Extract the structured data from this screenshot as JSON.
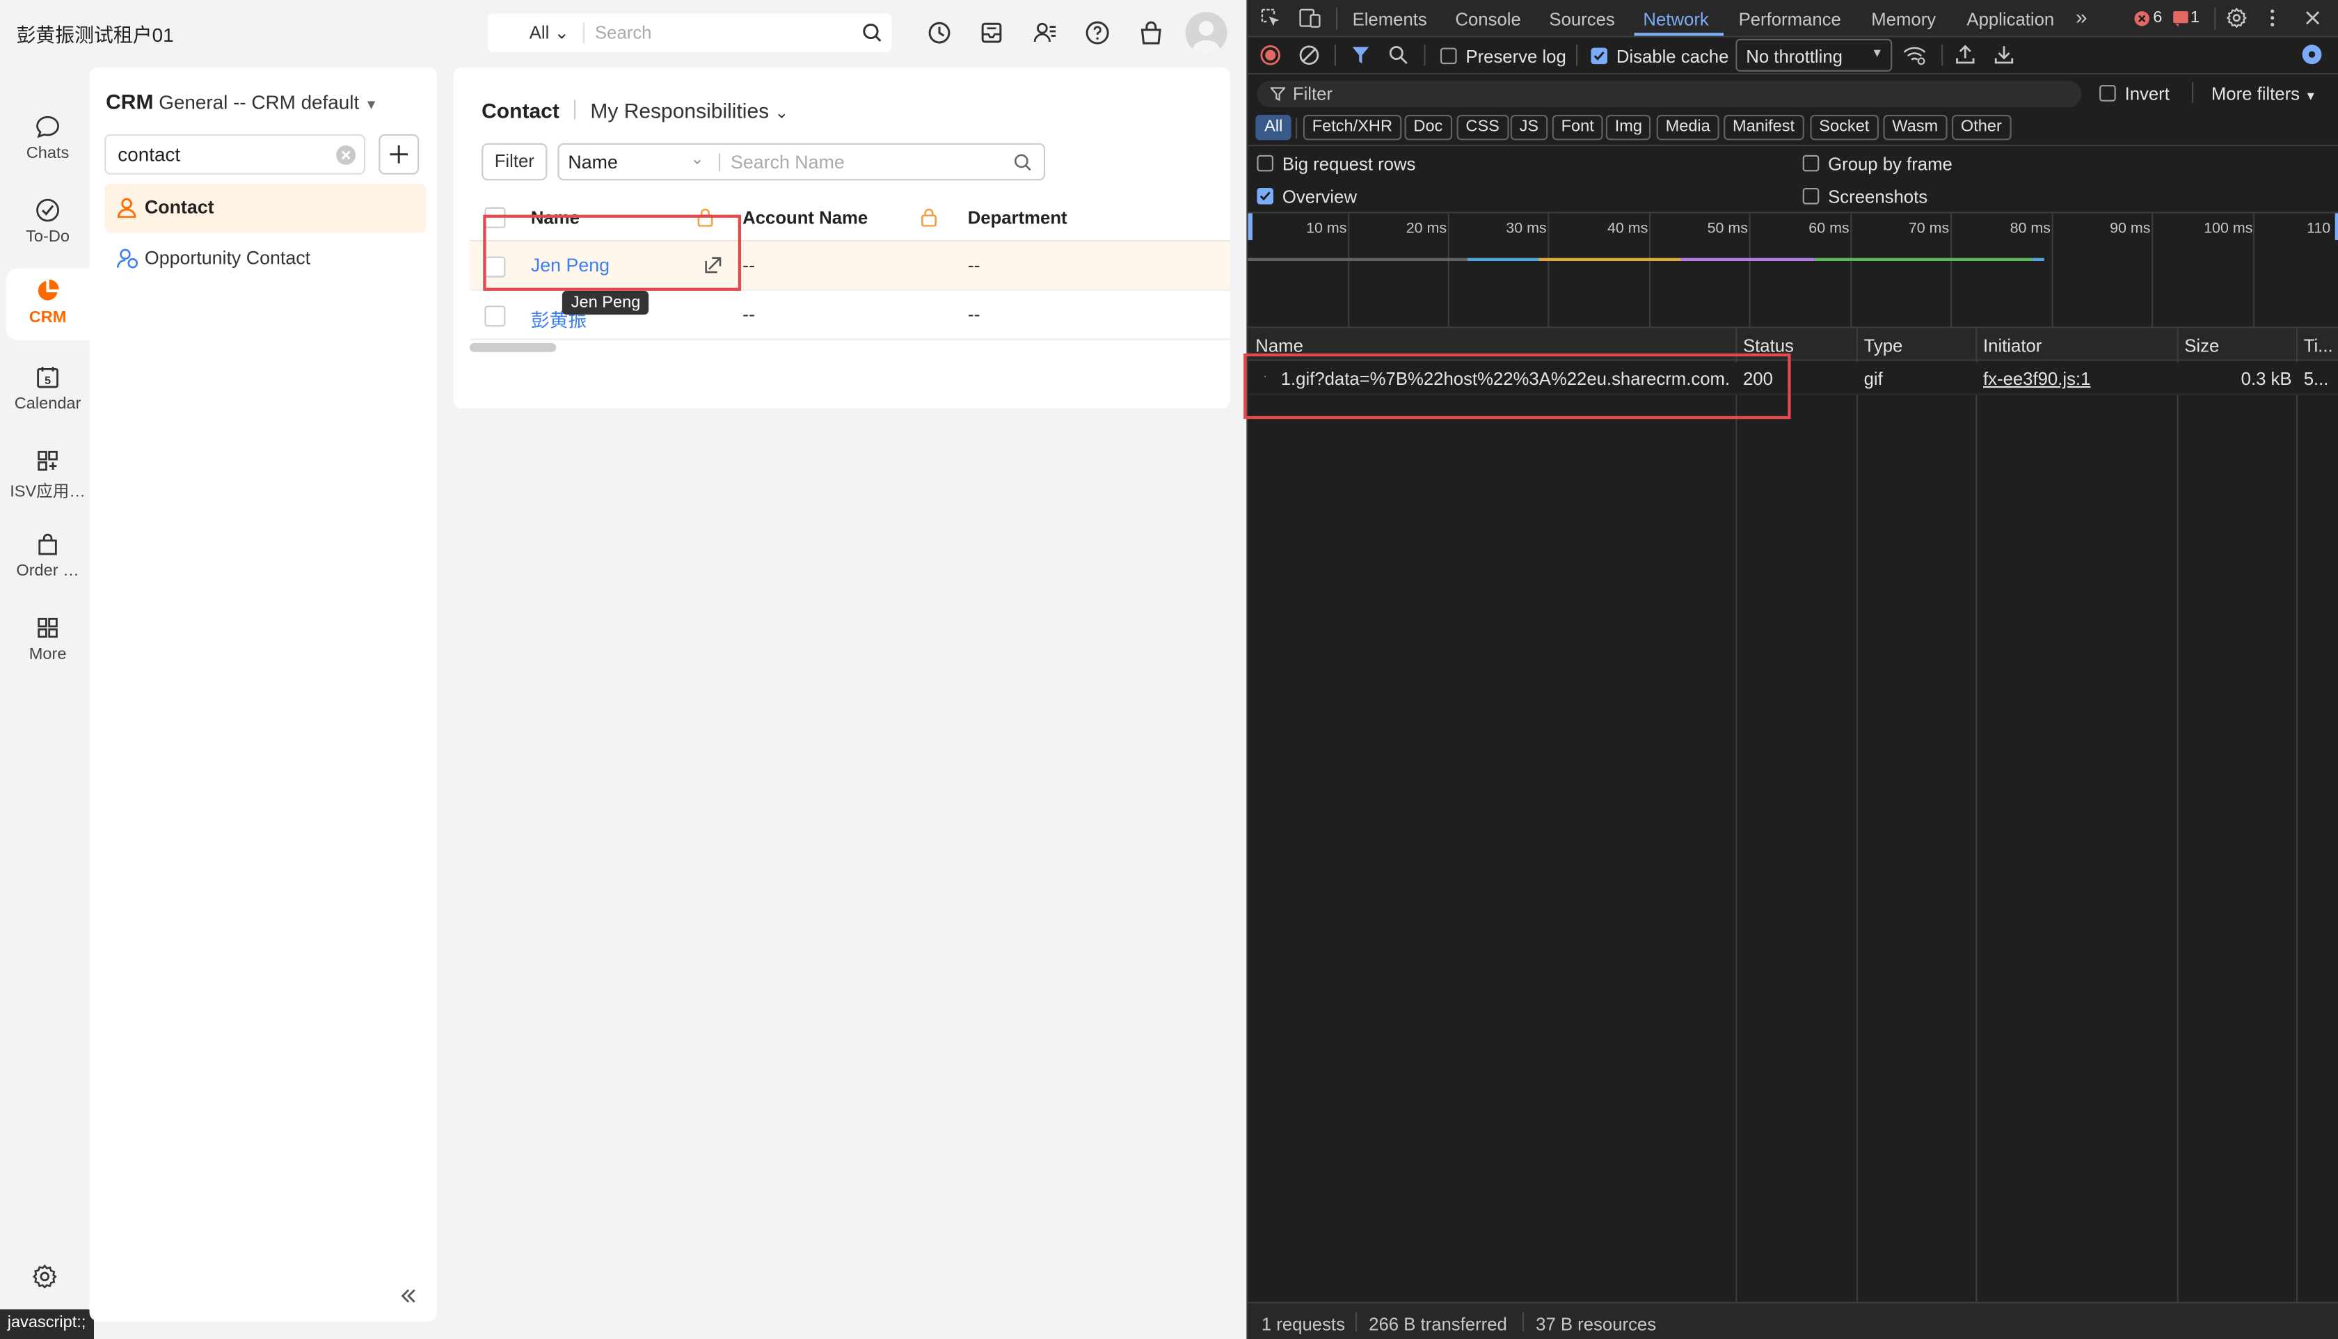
{
  "app": {
    "tenant_name": "彭黄振测试租户01",
    "search": {
      "scope": "All",
      "placeholder": "Search"
    },
    "nav": [
      {
        "label": "Chats",
        "icon": "chat-icon"
      },
      {
        "label": "To-Do",
        "icon": "check-circle-icon"
      },
      {
        "label": "CRM",
        "icon": "crm-pie-icon"
      },
      {
        "label": "Calendar",
        "icon": "calendar-icon"
      },
      {
        "label": "ISV应用…",
        "icon": "apps-icon"
      },
      {
        "label": "Order …",
        "icon": "bag-icon"
      },
      {
        "label": "More",
        "icon": "grid-icon"
      }
    ],
    "calendar_day": "5",
    "status_url": "javascript:;",
    "sidepanel": {
      "crm_label": "CRM",
      "view_label": "General -- CRM default",
      "object_search_value": "contact",
      "objects": [
        {
          "label": "Contact",
          "selected": true
        },
        {
          "label": "Opportunity Contact",
          "selected": false
        }
      ]
    },
    "list": {
      "object": "Contact",
      "view": "My Responsibilities",
      "filter_label": "Filter",
      "field": "Name",
      "search_placeholder": "Search Name",
      "columns": [
        "Name",
        "Account Name",
        "Department"
      ],
      "rows": [
        {
          "name": "Jen Peng",
          "account": "--",
          "department": "--"
        },
        {
          "name": "彭黄振",
          "account": "--",
          "department": "--"
        }
      ],
      "tooltip": "Jen Peng"
    }
  },
  "devtools": {
    "tabs": [
      "Elements",
      "Console",
      "Sources",
      "Network",
      "Performance",
      "Memory",
      "Application"
    ],
    "active_tab": "Network",
    "error_count": "6",
    "warning_count": "1",
    "preserve_log": "Preserve log",
    "disable_cache": "Disable cache",
    "throttling": "No throttling",
    "filter_placeholder": "Filter",
    "invert": "Invert",
    "more_filters": "More filters",
    "type_filters": [
      "All",
      "Fetch/XHR",
      "Doc",
      "CSS",
      "JS",
      "Font",
      "Img",
      "Media",
      "Manifest",
      "Socket",
      "Wasm",
      "Other"
    ],
    "options": {
      "big_rows": "Big request rows",
      "overview": "Overview",
      "group_by_frame": "Group by frame",
      "screenshots": "Screenshots"
    },
    "timeline_ticks": [
      "10 ms",
      "20 ms",
      "30 ms",
      "40 ms",
      "50 ms",
      "60 ms",
      "70 ms",
      "80 ms",
      "90 ms",
      "100 ms",
      "110"
    ],
    "columns": [
      "Name",
      "Status",
      "Type",
      "Initiator",
      "Size",
      "Ti..."
    ],
    "request": {
      "name": "1.gif?data=%7B%22host%22%3A%22eu.sharecrm.com...",
      "status": "200",
      "type": "gif",
      "initiator": "fx-ee3f90.js:1",
      "size": "0.3 kB",
      "time": "5..."
    },
    "footer": {
      "requests": "1 requests",
      "transferred": "266 B transferred",
      "resources": "37 B resources"
    }
  }
}
